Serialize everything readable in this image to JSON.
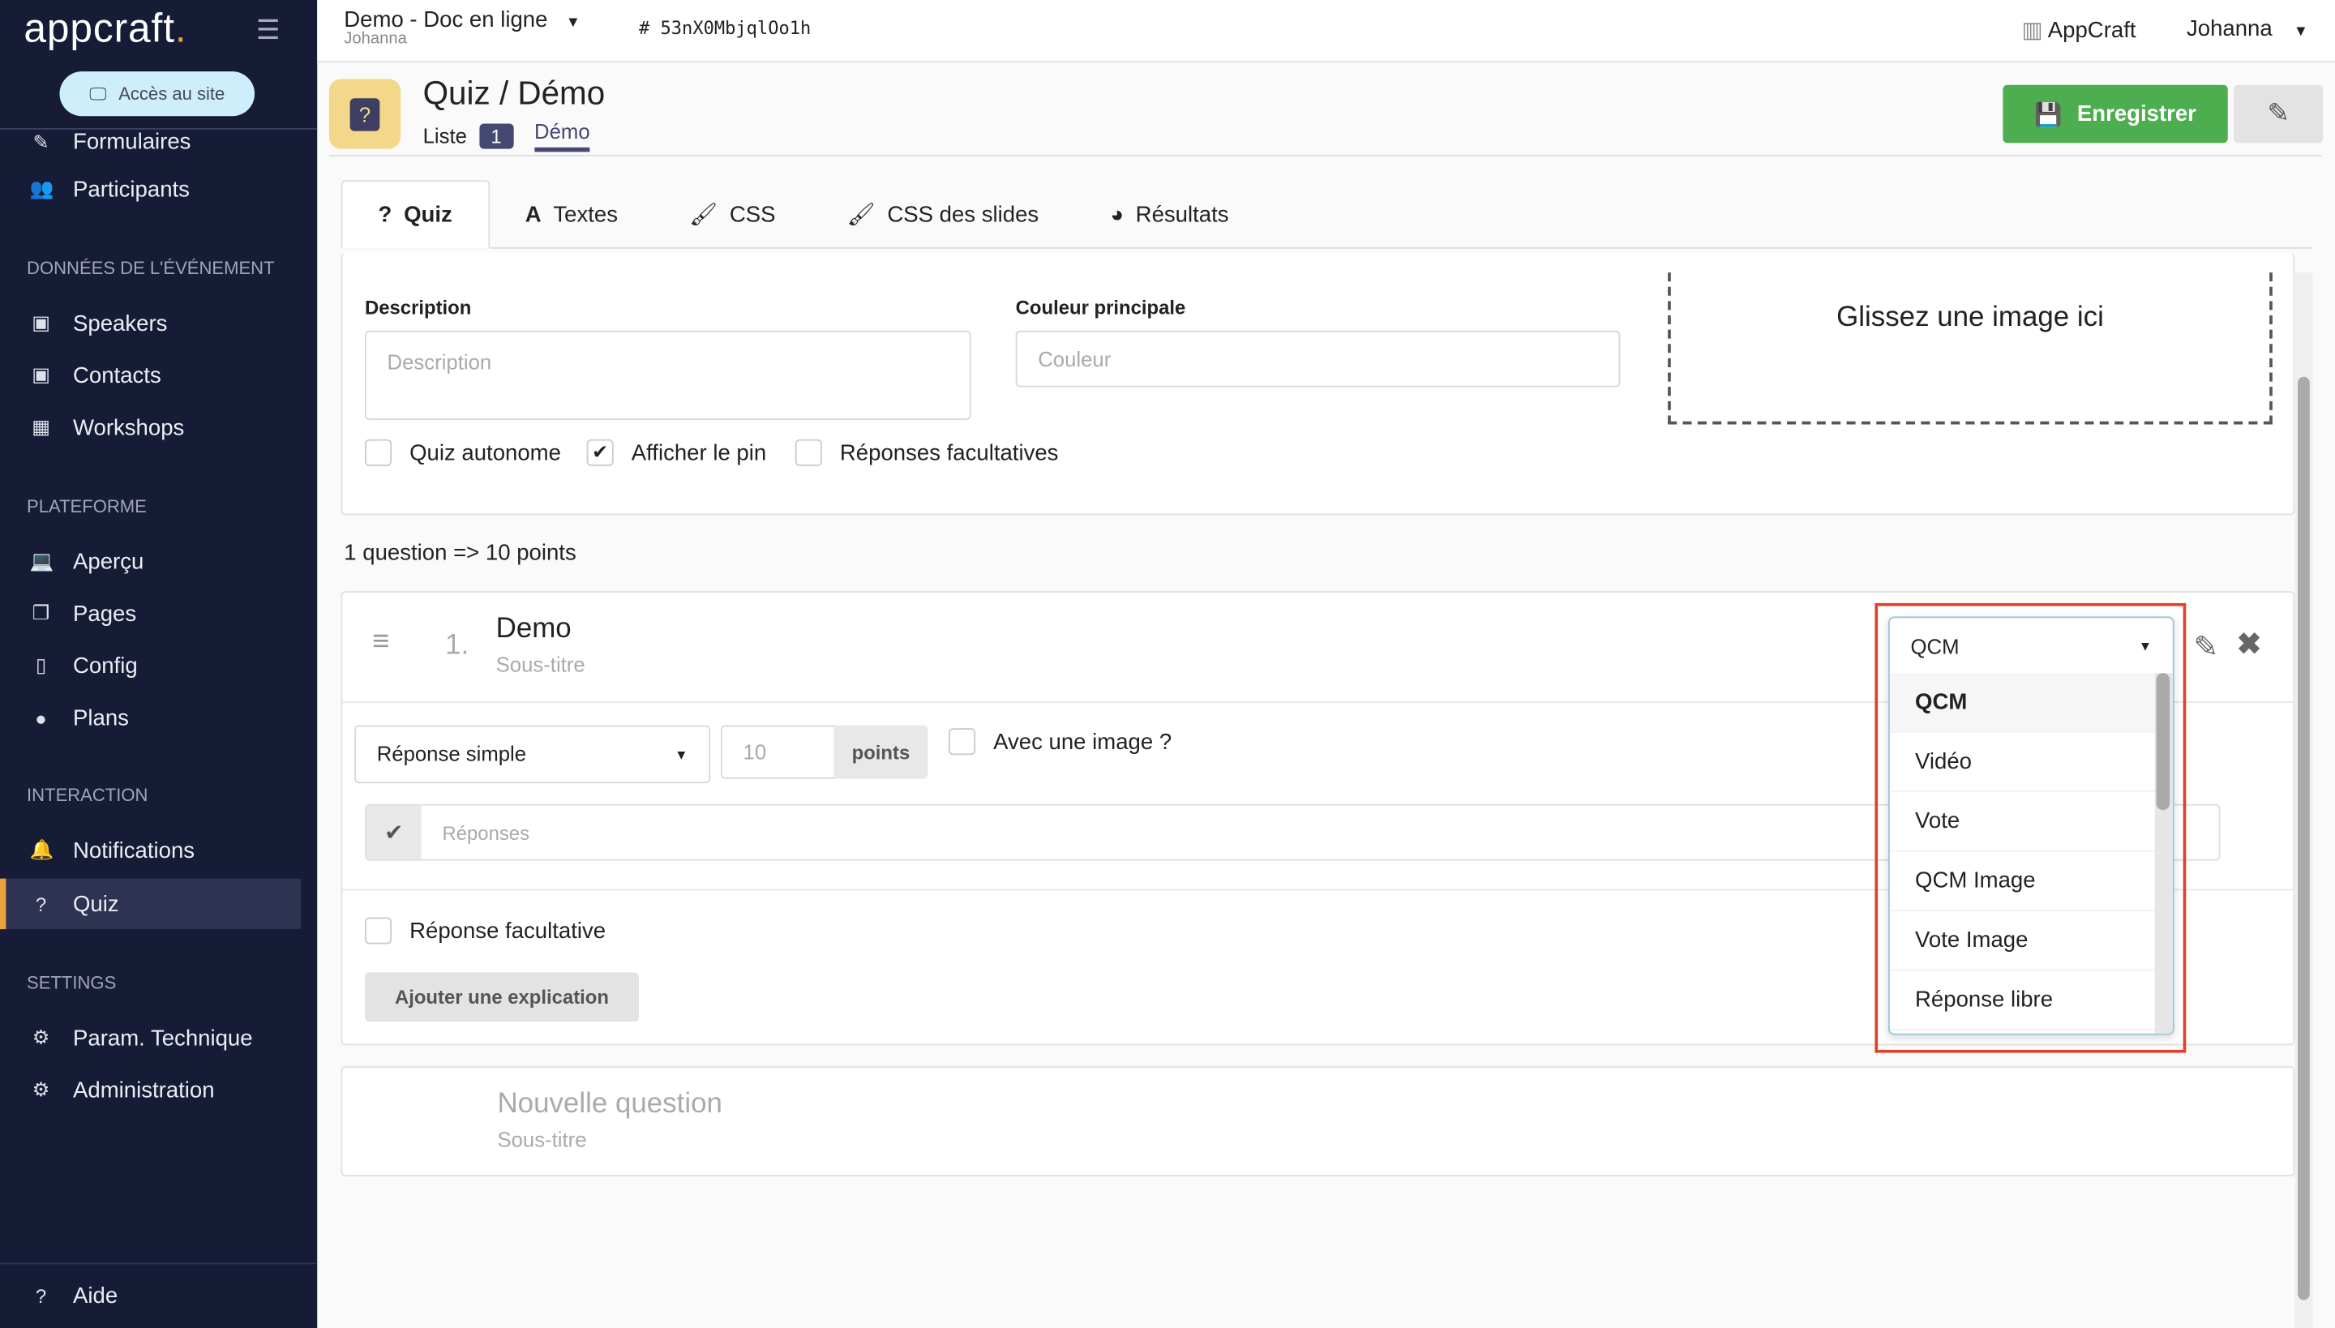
{
  "sidebar": {
    "logo": "appcraft",
    "logo_dot": ".",
    "site_button": "Accès au site",
    "items_top": [
      {
        "label": "Formulaires"
      },
      {
        "label": "Participants"
      }
    ],
    "sections": [
      {
        "title": "Données de l'événement",
        "items": [
          "Speakers",
          "Contacts",
          "Workshops"
        ]
      },
      {
        "title": "Plateforme",
        "items": [
          "Aperçu",
          "Pages",
          "Config",
          "Plans"
        ]
      },
      {
        "title": "Interaction",
        "items": [
          "Notifications",
          "Quiz"
        ]
      },
      {
        "title": "Settings",
        "items": [
          "Param. Technique",
          "Administration"
        ]
      }
    ],
    "help": "Aide"
  },
  "topbar": {
    "project": "Demo - Doc en ligne",
    "user_sub": "Johanna",
    "hash": "53nX0MbjqlOo1h",
    "org": "AppCraft",
    "user": "Johanna"
  },
  "header": {
    "title": "Quiz / Démo",
    "list_label": "Liste",
    "list_count": "1",
    "current": "Démo",
    "save": "Enregistrer"
  },
  "tabs": [
    "Quiz",
    "Textes",
    "CSS",
    "CSS des slides",
    "Résultats"
  ],
  "settings": {
    "description_label": "Description",
    "description_placeholder": "Description",
    "color_label": "Couleur principale",
    "color_placeholder": "Couleur",
    "dropzone": "Glissez une image ici",
    "checks": [
      {
        "label": "Quiz autonome",
        "checked": false
      },
      {
        "label": "Afficher le pin",
        "checked": true
      },
      {
        "label": "Réponses facultatives",
        "checked": false
      }
    ]
  },
  "summary": "1 question => 10 points",
  "question": {
    "number": "1.",
    "title": "Demo",
    "subtitle": "Sous-titre",
    "answer_type": "Réponse simple",
    "points_value": "10",
    "points_label": "points",
    "with_image": "Avec une image ?",
    "answers_placeholder": "Réponses",
    "optional": "Réponse facultative",
    "add_explanation": "Ajouter une explication",
    "type_select": {
      "value": "QCM",
      "options": [
        "QCM",
        "Vidéo",
        "Vote",
        "QCM Image",
        "Vote Image",
        "Réponse libre"
      ]
    }
  },
  "new_question": {
    "title": "Nouvelle question",
    "subtitle": "Sous-titre"
  }
}
